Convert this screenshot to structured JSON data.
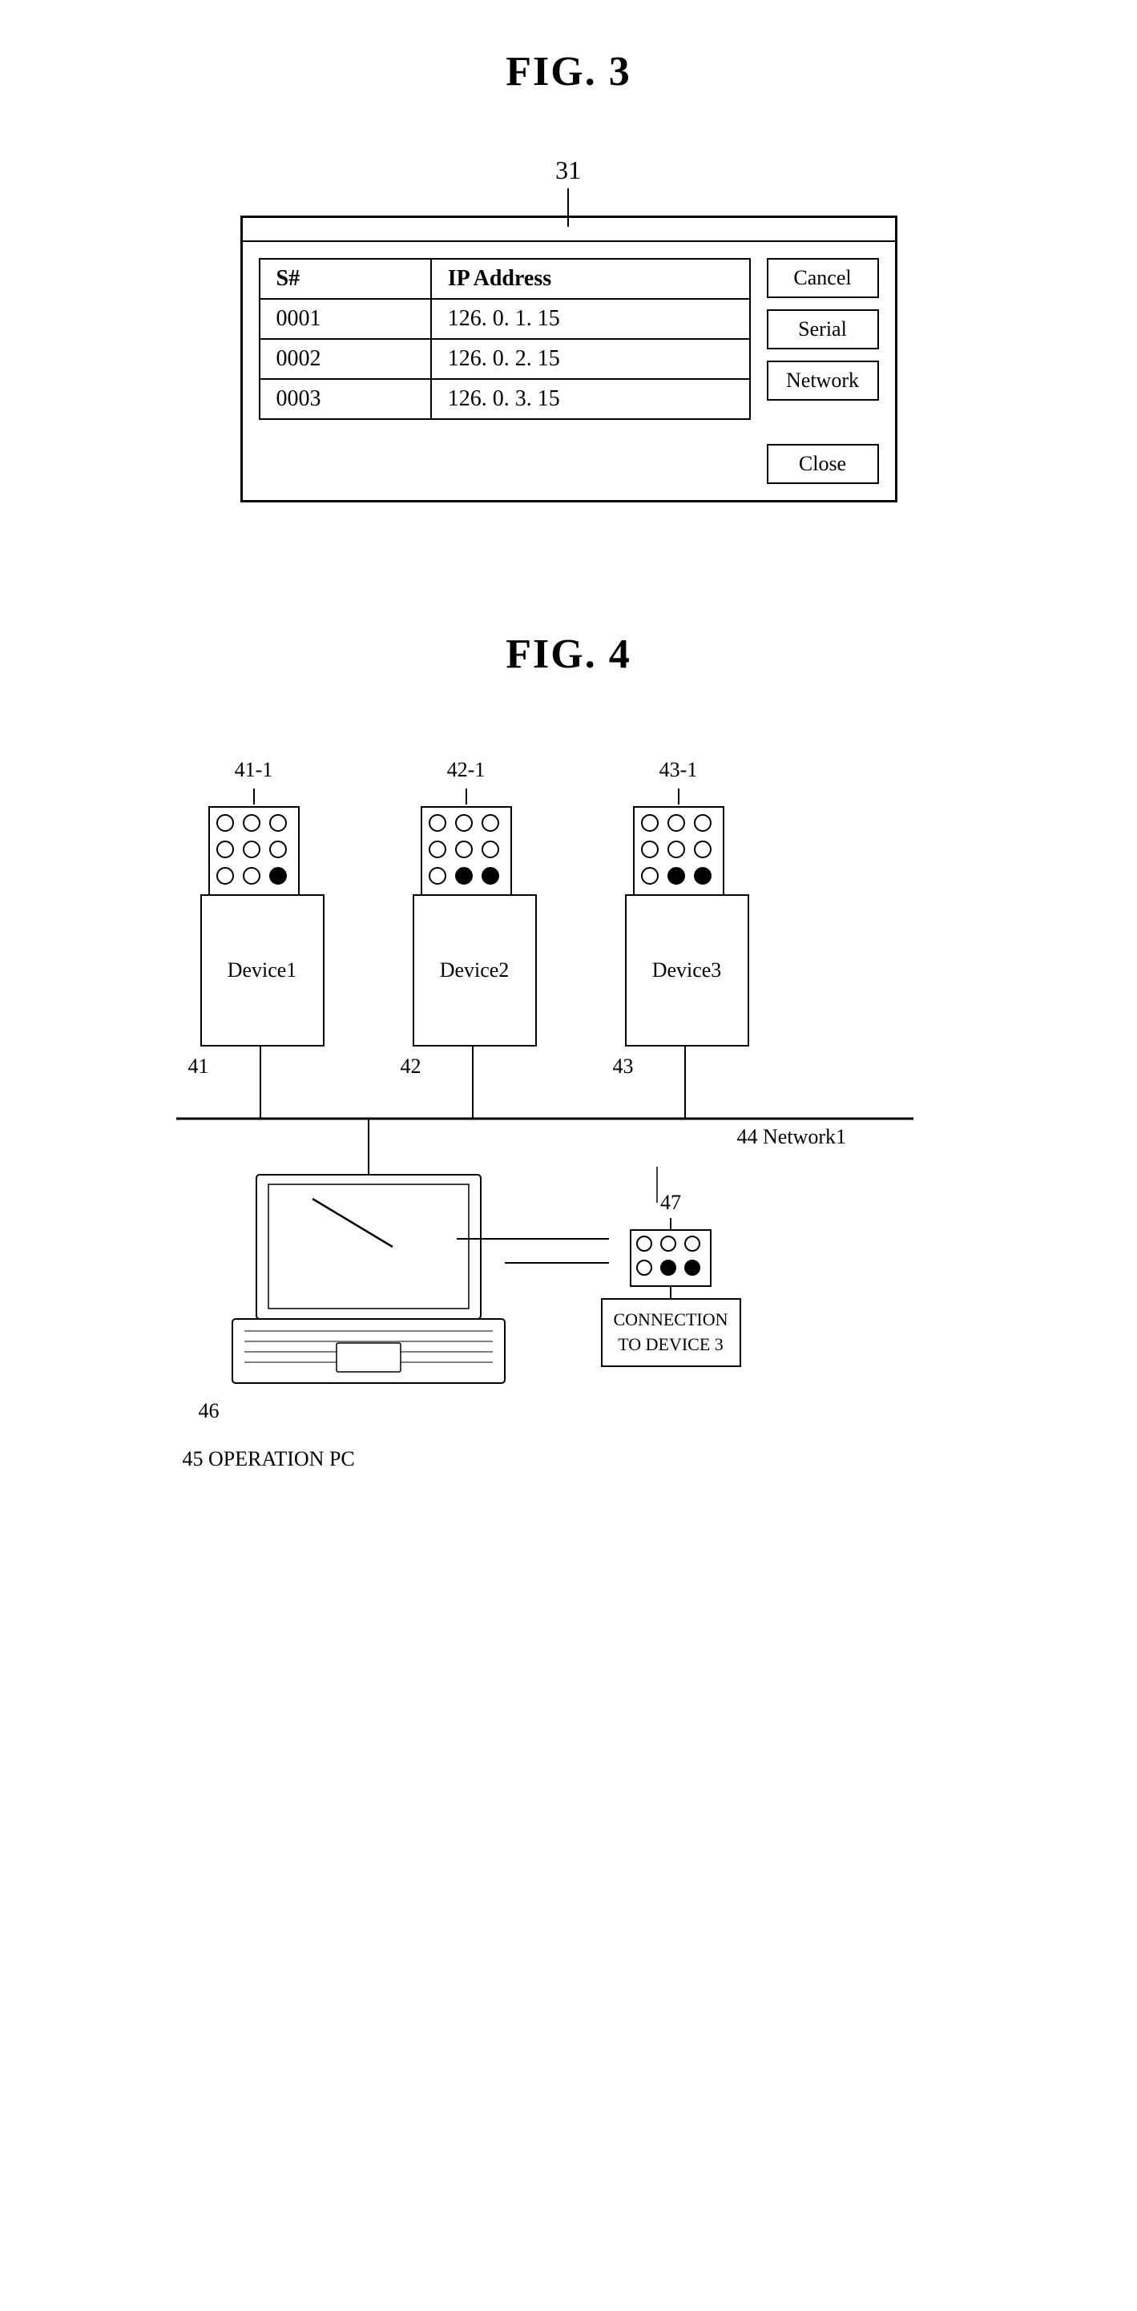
{
  "fig3": {
    "title": "FIG. 3",
    "dialog_ref": "31",
    "titlebar": "",
    "table": {
      "headers": [
        "S#",
        "IP  Address"
      ],
      "rows": [
        [
          "0001",
          "126. 0. 1. 15"
        ],
        [
          "0002",
          "126. 0. 2. 15"
        ],
        [
          "0003",
          "126. 0. 3. 15"
        ]
      ]
    },
    "buttons": {
      "cancel": "Cancel",
      "serial": "Serial",
      "network": "Network",
      "close": "Close"
    }
  },
  "fig4": {
    "title": "FIG. 4",
    "refs": {
      "panel1": "41-1",
      "panel2": "42-1",
      "panel3": "43-1",
      "device1_label": "41",
      "device2_label": "42",
      "device3_label": "43",
      "network_label": "44  Network1",
      "laptop_label": "46",
      "operation_pc": "45  OPERATION PC",
      "led_panel_ref": "47",
      "connection_box_text": "CONNECTION\nTO DEVICE 3"
    },
    "devices": [
      {
        "name": "Device1"
      },
      {
        "name": "Device2"
      },
      {
        "name": "Device3"
      }
    ]
  }
}
